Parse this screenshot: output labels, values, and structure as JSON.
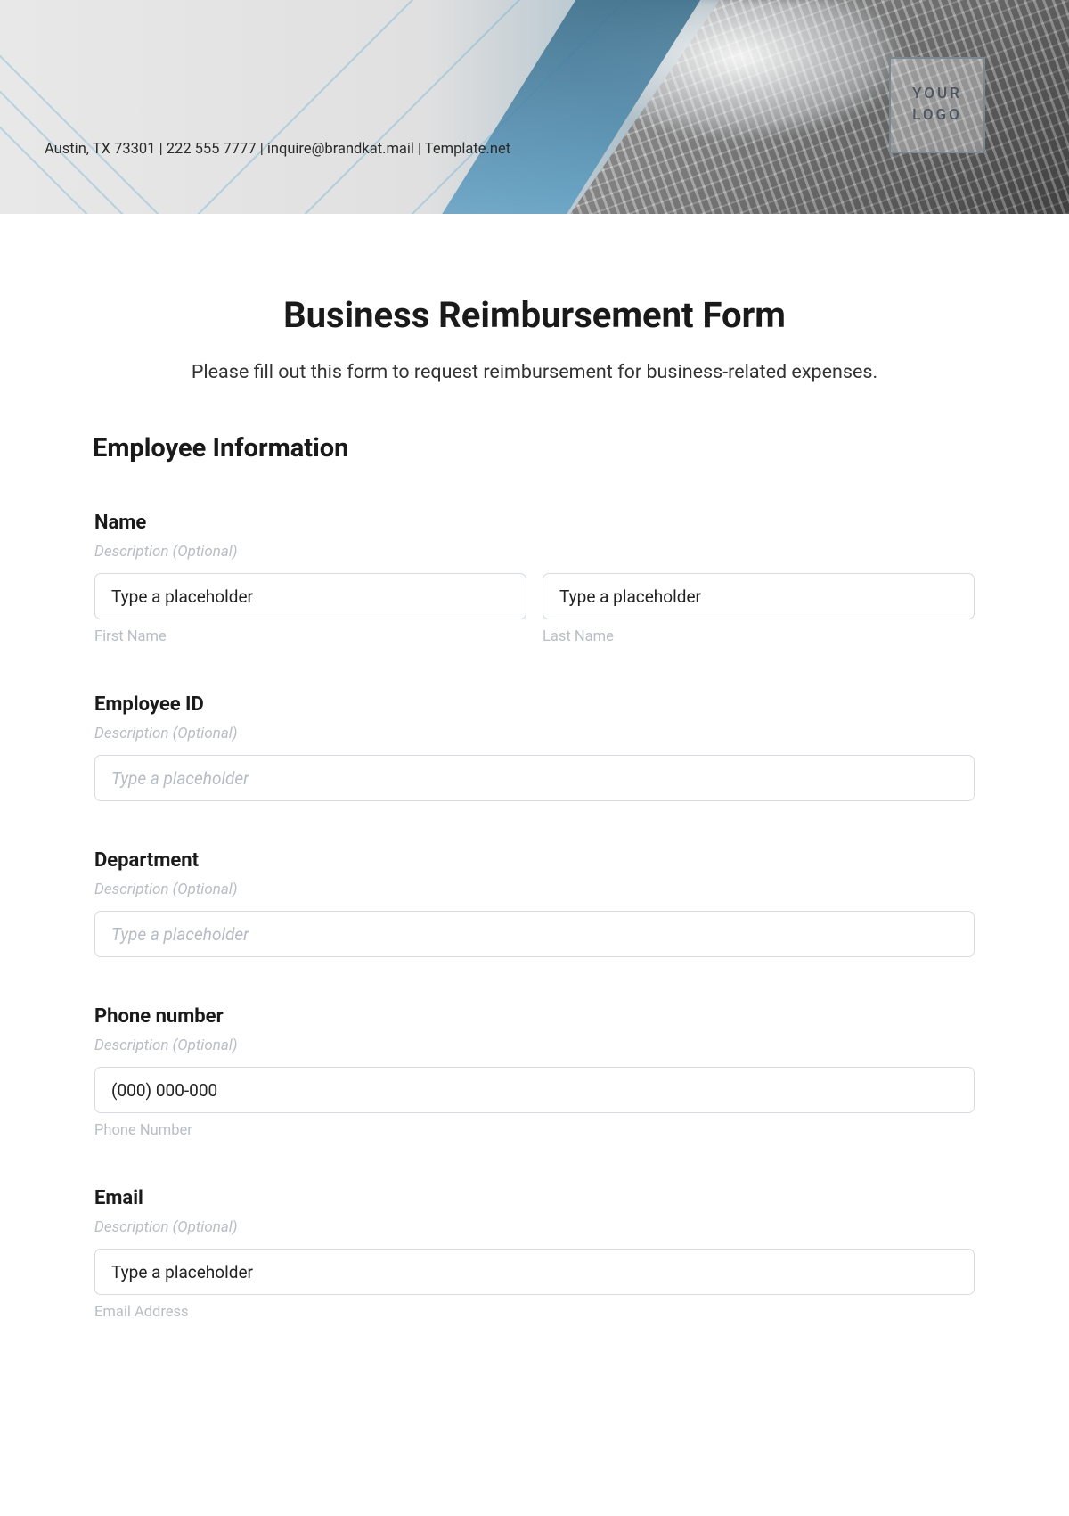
{
  "header": {
    "contact_line": "Austin, TX 73301 | 222 555 7777 | inquire@brandkat.mail | Template.net",
    "logo_text": "YOUR\nLOGO"
  },
  "form": {
    "title": "Business Reimbursement Form",
    "subtitle": "Please fill out this form to request reimbursement for business-related expenses.",
    "section_heading": "Employee Information",
    "fields": {
      "name": {
        "label": "Name",
        "description": "Description (Optional)",
        "first_value": "Type a placeholder",
        "first_sub": "First Name",
        "last_value": "Type a placeholder",
        "last_sub": "Last Name"
      },
      "employee_id": {
        "label": "Employee ID",
        "description": "Description (Optional)",
        "placeholder": "Type a placeholder"
      },
      "department": {
        "label": "Department",
        "description": "Description (Optional)",
        "placeholder": "Type a placeholder"
      },
      "phone": {
        "label": "Phone number",
        "description": "Description (Optional)",
        "value": "(000) 000-000",
        "sub": "Phone Number"
      },
      "email": {
        "label": "Email",
        "description": "Description (Optional)",
        "value": "Type a placeholder",
        "sub": "Email Address"
      }
    }
  }
}
